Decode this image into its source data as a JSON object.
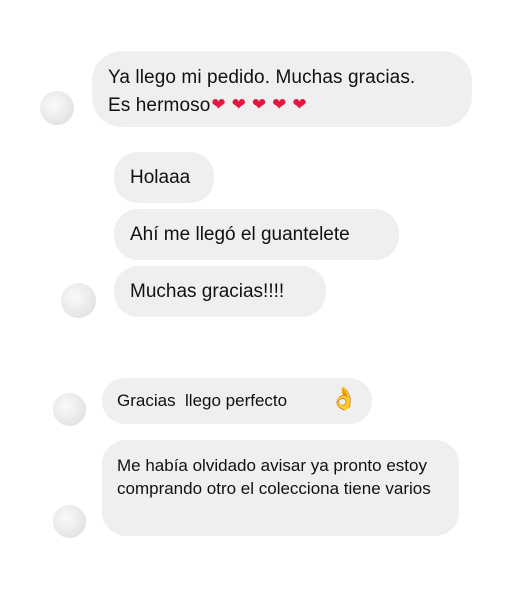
{
  "messages": [
    {
      "line1": "Ya llego mi pedido. Muchas gracias.",
      "line2": "Es hermoso",
      "hearts": "❤❤❤❤❤",
      "heart_color": "#e5173f"
    },
    {
      "text": "Holaaa"
    },
    {
      "text": "Ahí me llegó el guantelete"
    },
    {
      "text": "Muchas gracias!!!!"
    },
    {
      "text": "Gracias  llego perfecto",
      "emoji": "👌"
    },
    {
      "text": "Me había olvidado avisar ya pronto estoy comprando otro el colecciona tiene varios"
    }
  ],
  "colors": {
    "bubble": "#efefef",
    "background": "#ffffff",
    "text": "#111111"
  }
}
